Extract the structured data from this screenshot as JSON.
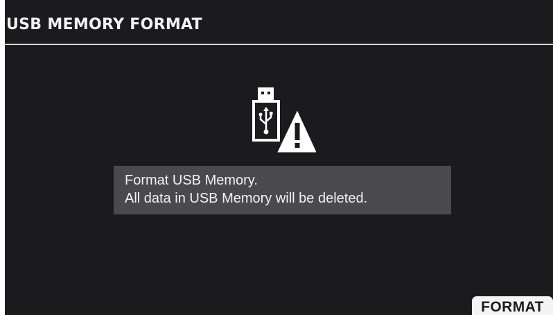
{
  "header": {
    "title": "USB MEMORY FORMAT"
  },
  "icon": {
    "name": "usb-memory-warning-icon"
  },
  "message": {
    "line1": "Format USB Memory.",
    "line2": "All data in USB Memory will be deleted."
  },
  "footer": {
    "format_label": "FORMAT"
  },
  "colors": {
    "background": "#1b1b1d",
    "text": "#f2f2f2",
    "message_bg": "#4a4a4c",
    "button_bg": "#f4f4f4"
  }
}
